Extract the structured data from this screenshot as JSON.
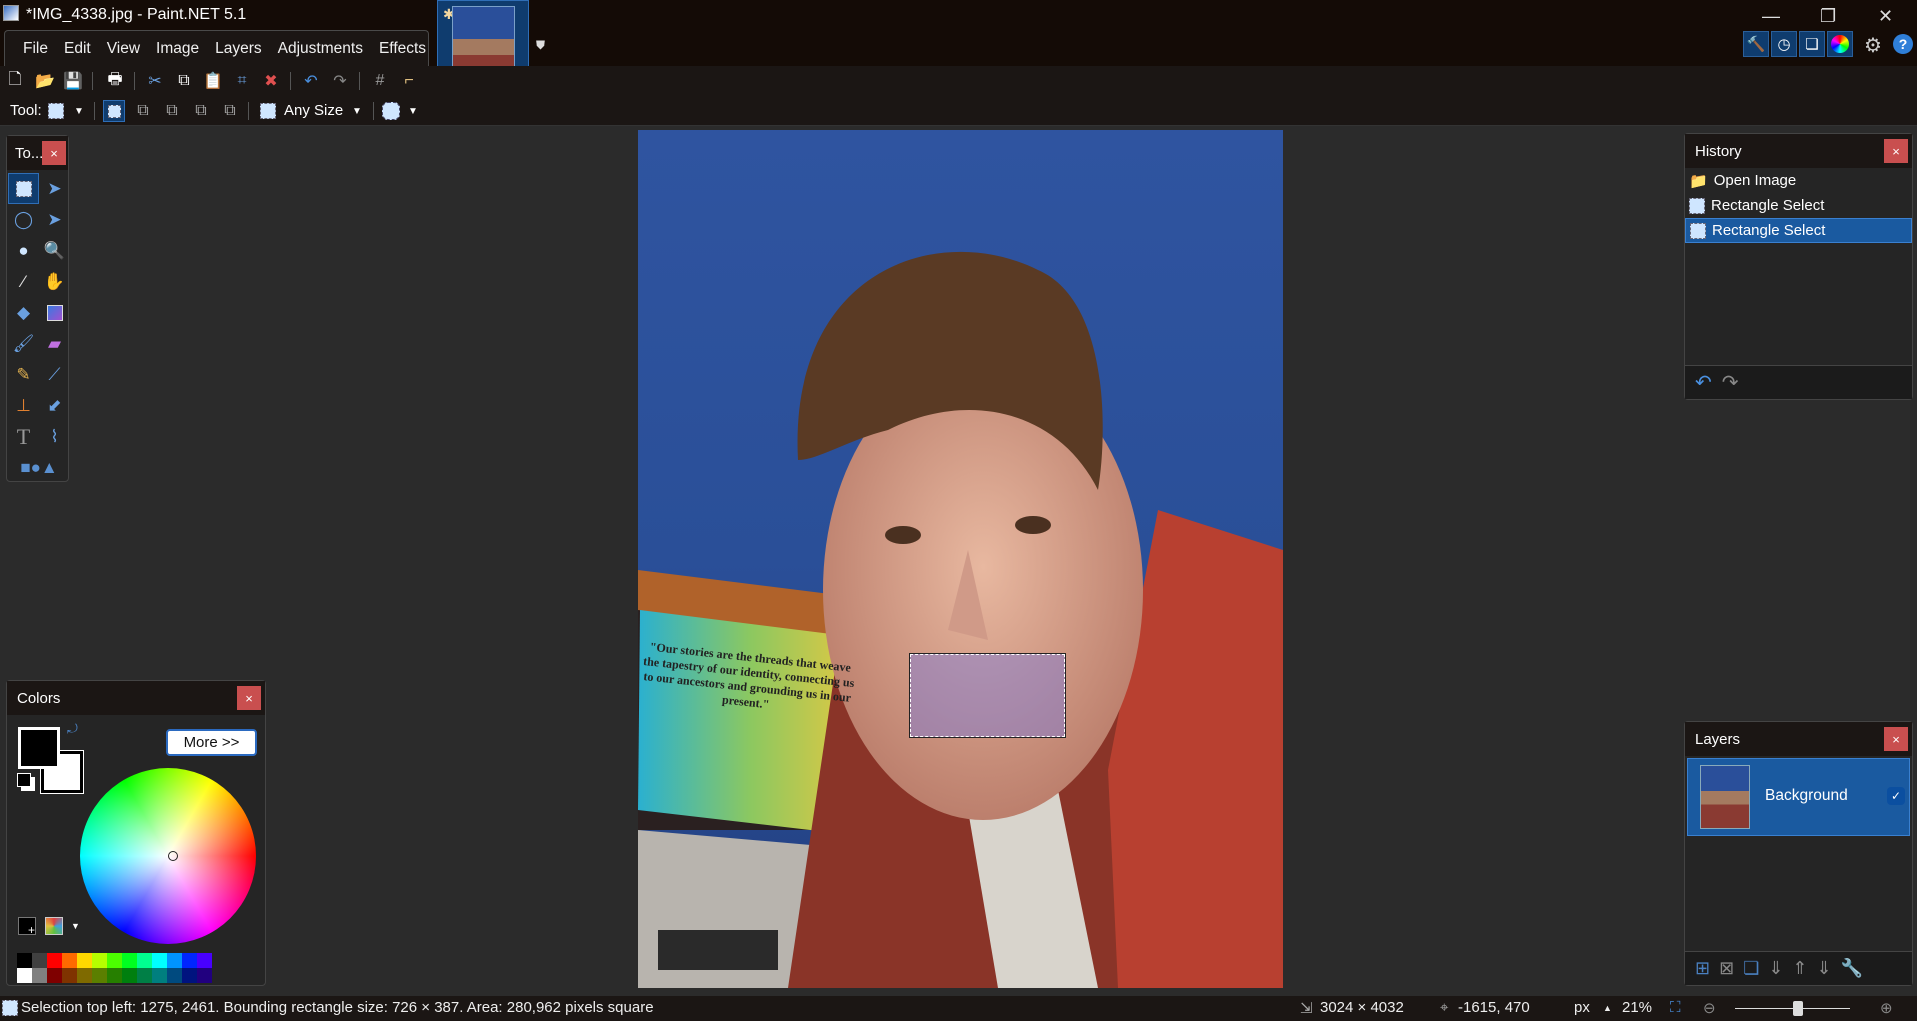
{
  "window": {
    "title": "*IMG_4338.jpg - Paint.NET 5.1"
  },
  "menu": [
    "File",
    "Edit",
    "View",
    "Image",
    "Layers",
    "Adjustments",
    "Effects"
  ],
  "toolbar": {
    "tool_label": "Tool:",
    "size_mode": "Any Size"
  },
  "tools_panel": {
    "title": "To...",
    "close": "×"
  },
  "history": {
    "title": "History",
    "close": "×",
    "items": [
      {
        "label": "Open Image",
        "icon": "open-folder-icon"
      },
      {
        "label": "Rectangle Select",
        "icon": "rectangle-select-icon"
      },
      {
        "label": "Rectangle Select",
        "icon": "rectangle-select-icon",
        "selected": true
      }
    ]
  },
  "layers": {
    "title": "Layers",
    "close": "×",
    "items": [
      {
        "name": "Background",
        "visible": true,
        "selected": true
      }
    ]
  },
  "colors": {
    "title": "Colors",
    "close": "×",
    "more_label": "More >>",
    "primary": "#000000",
    "secondary": "#ffffff",
    "palette_top": [
      "#000000",
      "#404040",
      "#ff0000",
      "#ff6a00",
      "#ffd800",
      "#b6ff00",
      "#4cff00",
      "#00ff21",
      "#00ff90",
      "#00ffff",
      "#0094ff",
      "#0026ff",
      "#4800ff",
      "#b200ff",
      "#ff00dc",
      "#ff006e"
    ],
    "palette_bottom": [
      "#ffffff",
      "#808080",
      "#7f0000",
      "#7f3300",
      "#7f6a00",
      "#5b7f00",
      "#267f00",
      "#007f0e",
      "#007f46",
      "#007f7f",
      "#004a7f",
      "#00137f",
      "#21007f",
      "#57007f",
      "#7f006e",
      "#7f0037"
    ]
  },
  "photo": {
    "poster_text": "\"Our stories are the threads that weave the tapestry of our identity, connecting us to our ancestors and grounding us in our present.\""
  },
  "status": {
    "selection": "Selection top left: 1275, 2461. Bounding rectangle size: 726 × 387. Area: 280,962 pixels square",
    "image_size": "3024 × 4032",
    "cursor_pos": "-1615, 470",
    "units": "px",
    "zoom": "21%",
    "zoom_slider_fraction": 0.55
  },
  "accent": "#1a5aa0"
}
